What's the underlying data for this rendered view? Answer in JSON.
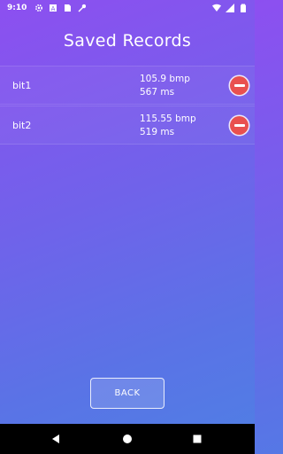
{
  "status_bar": {
    "time": "9:10",
    "left_icons": [
      "gear-icon",
      "shield-a-icon",
      "sim-icon",
      "wrench-icon"
    ],
    "right_icons": [
      "wifi-icon",
      "signal-icon",
      "battery-icon"
    ]
  },
  "header": {
    "title": "Saved Records"
  },
  "records": [
    {
      "name": "bit1",
      "bpm": "105.9 bmp",
      "ms": "567 ms"
    },
    {
      "name": "bit2",
      "bpm": "115.55 bmp",
      "ms": "519 ms"
    }
  ],
  "delete_icon": "minus-circle-icon",
  "back_button": {
    "label": "BACK"
  },
  "nav_bar": {
    "icons": [
      "back-triangle-icon",
      "home-circle-icon",
      "recents-square-icon"
    ]
  },
  "colors": {
    "gradient_top": "#8d4ff0",
    "gradient_bottom": "#4f7fe4",
    "delete_red": "#e9504f",
    "nav_black": "#000000"
  }
}
